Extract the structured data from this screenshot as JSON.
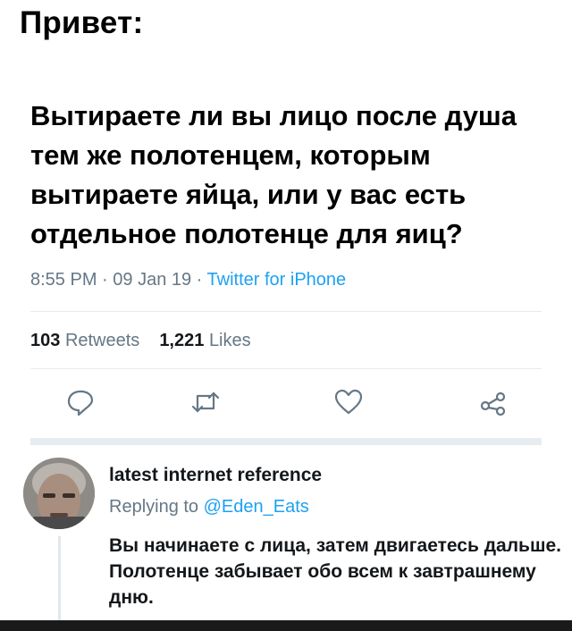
{
  "header": {
    "title": "Привет:"
  },
  "tweet": {
    "text": "Вытираете ли вы лицо после душа тем же полотенцем, которым вытираете яйца, или у вас есть отдельное полотенце для яиц?",
    "time": "8:55 PM",
    "date": "09 Jan 19",
    "separator": " · ",
    "source": "Twitter for iPhone",
    "retweets_count": "103",
    "retweets_label": "Retweets",
    "likes_count": "1,221",
    "likes_label": "Likes"
  },
  "actions": {
    "icons": [
      "reply-icon",
      "retweet-icon",
      "like-icon",
      "share-icon"
    ],
    "color": "#657786"
  },
  "reply": {
    "author": "latest internet reference",
    "replying_prefix": "Replying to",
    "replying_handle": "@Eden_Eats",
    "text": "Вы начинаете с лица, затем двигаетесь дальше. Полотенце забывает обо всем к завтрашнему дню."
  },
  "colors": {
    "link": "#1da1f2",
    "muted": "#657786",
    "divider": "#e6ecf0"
  }
}
